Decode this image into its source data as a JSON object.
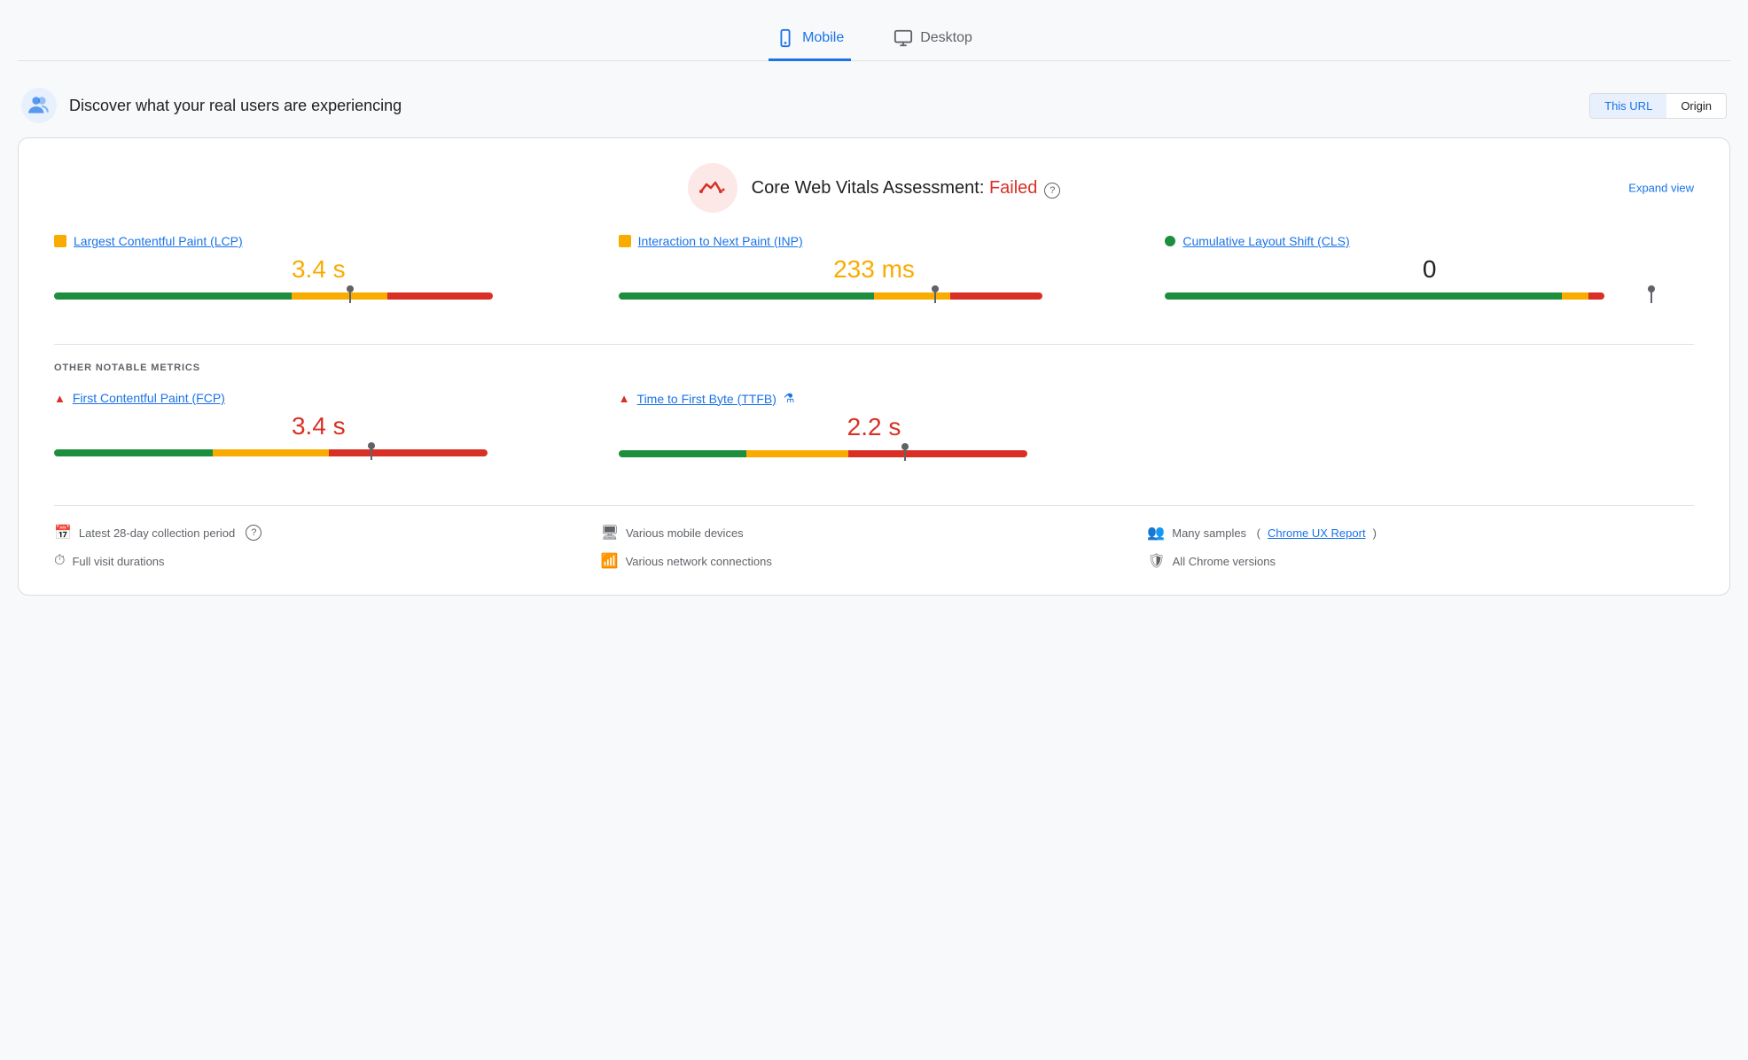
{
  "tabs": [
    {
      "id": "mobile",
      "label": "Mobile",
      "active": true
    },
    {
      "id": "desktop",
      "label": "Desktop",
      "active": false
    }
  ],
  "header": {
    "title": "Discover what your real users are experiencing",
    "url_toggle": {
      "this_url": "This URL",
      "origin": "Origin"
    }
  },
  "cwv": {
    "assessment_prefix": "Core Web Vitals Assessment: ",
    "status": "Failed",
    "expand_label": "Expand view"
  },
  "metrics": [
    {
      "id": "lcp",
      "name": "Largest Contentful Paint (LCP)",
      "value": "3.4 s",
      "value_color": "orange",
      "dot_type": "square-orange",
      "bar": {
        "green": 45,
        "orange": 18,
        "red": 20,
        "needle_pct": 56
      }
    },
    {
      "id": "inp",
      "name": "Interaction to Next Paint (INP)",
      "value": "233 ms",
      "value_color": "orange",
      "dot_type": "square-orange",
      "bar": {
        "green": 50,
        "orange": 15,
        "red": 18,
        "needle_pct": 62
      }
    },
    {
      "id": "cls",
      "name": "Cumulative Layout Shift (CLS)",
      "value": "0",
      "value_color": "normal",
      "dot_type": "circle-green",
      "bar": {
        "green": 75,
        "orange": 5,
        "red": 3,
        "needle_pct": 92
      }
    }
  ],
  "other_metrics_label": "OTHER NOTABLE METRICS",
  "other_metrics": [
    {
      "id": "fcp",
      "name": "First Contentful Paint (FCP)",
      "value": "3.4 s",
      "value_color": "red",
      "icon_type": "triangle-red",
      "bar": {
        "green": 30,
        "orange": 22,
        "red": 30,
        "needle_pct": 60
      }
    },
    {
      "id": "ttfb",
      "name": "Time to First Byte (TTFB)",
      "value": "2.2 s",
      "value_color": "red",
      "icon_type": "triangle-red",
      "has_flask": true,
      "bar": {
        "green": 25,
        "orange": 20,
        "red": 35,
        "needle_pct": 56
      }
    }
  ],
  "footer": {
    "items": [
      {
        "icon": "calendar",
        "text": "Latest 28-day collection period",
        "has_help": true
      },
      {
        "icon": "monitor",
        "text": "Various mobile devices"
      },
      {
        "icon": "users",
        "text": "Many samples",
        "link": "Chrome UX Report"
      },
      {
        "icon": "clock",
        "text": "Full visit durations"
      },
      {
        "icon": "wifi",
        "text": "Various network connections"
      },
      {
        "icon": "shield",
        "text": "All Chrome versions"
      }
    ]
  }
}
